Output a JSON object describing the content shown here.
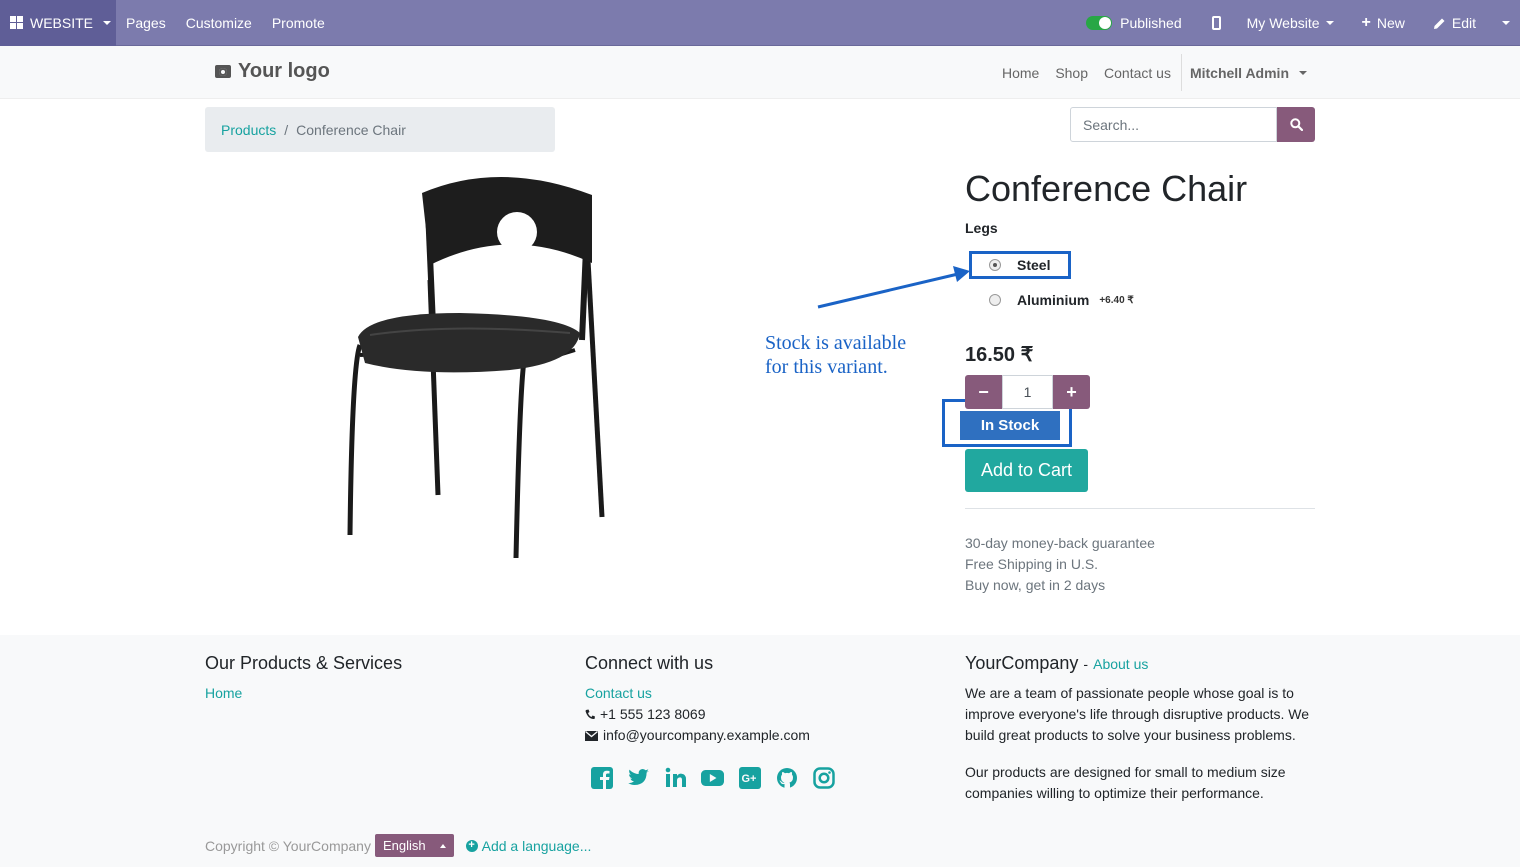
{
  "admin_bar": {
    "website_label": "WEBSITE",
    "menu": [
      "Pages",
      "Customize",
      "Promote"
    ],
    "published_label": "Published",
    "my_website_label": "My Website",
    "new_label": "New",
    "edit_label": "Edit"
  },
  "header": {
    "logo_text": "Your logo",
    "nav": [
      "Home",
      "Shop",
      "Contact us"
    ],
    "user": "Mitchell Admin"
  },
  "breadcrumb": {
    "parent": "Products",
    "separator": "/",
    "current": "Conference Chair"
  },
  "search": {
    "placeholder": "Search..."
  },
  "product": {
    "name": "Conference Chair",
    "attribute_label": "Legs",
    "options": [
      {
        "label": "Steel",
        "extra": "",
        "selected": true
      },
      {
        "label": "Aluminium",
        "extra": "+6.40 ₹",
        "selected": false
      }
    ],
    "price": "16.50 ₹",
    "quantity": "1",
    "stock_label": "In Stock",
    "add_to_cart": "Add to Cart",
    "guarantees": [
      "30-day money-back guarantee",
      "Free Shipping in U.S.",
      "Buy now, get in 2 days"
    ]
  },
  "annotation": {
    "line1": "Stock is available",
    "line2": "for this variant."
  },
  "footer": {
    "col1_title": "Our Products & Services",
    "col1_links": [
      "Home"
    ],
    "col2_title": "Connect with us",
    "contact_link": "Contact us",
    "phone": "+1 555 123 8069",
    "email": "info@yourcompany.example.com",
    "col3_company": "YourCompany",
    "col3_dash": "-",
    "col3_about": "About us",
    "col3_p1": "We are a team of passionate people whose goal is to improve everyone's life through disruptive products. We build great products to solve your business problems.",
    "col3_p2": "Our products are designed for small to medium size companies willing to optimize their performance.",
    "copyright": "Copyright © YourCompany",
    "language": "English",
    "add_language": "Add a language..."
  },
  "colors": {
    "admin_bar": "#7c7bad",
    "primary": "#875a7b",
    "link": "#17a2a0",
    "annotation": "#1a63c6"
  }
}
